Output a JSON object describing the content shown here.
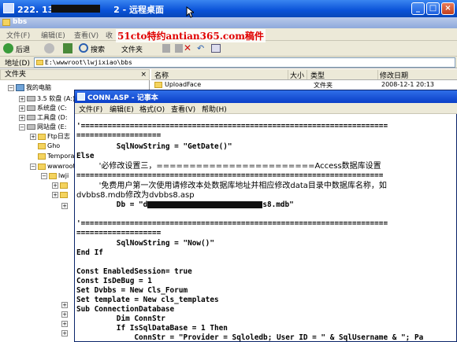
{
  "rdp_window": {
    "title_prefix": "222. 134.",
    "title_suffix": "2 - 远程桌面",
    "buttons": [
      "_",
      "□",
      "×"
    ]
  },
  "explorer": {
    "title": "bbs",
    "menu": [
      "文件(F)",
      "编辑(E)",
      "查看(V)",
      "收"
    ],
    "toolbar": {
      "back": "后退",
      "search": "搜索",
      "folders": "文件夹"
    },
    "address_label": "地址(D)",
    "address_value": "E:\\wwwroot\\lwjixiao\\bbs",
    "promo_text": "51cto特约antian365.com稿件",
    "folder_pane_title": "文件夹",
    "tree": [
      {
        "label": "我的电脑",
        "indent": 0,
        "icon": "computer-icon"
      },
      {
        "label": "3.5 软盘 (A:)",
        "indent": 1,
        "icon": "floppy-icon"
      },
      {
        "label": "系统盘 (C:",
        "indent": 1,
        "icon": "drive-icon"
      },
      {
        "label": "工具盘 (D:",
        "indent": 1,
        "icon": "drive-icon"
      },
      {
        "label": "网站盘 (E:",
        "indent": 1,
        "icon": "drive-icon"
      },
      {
        "label": "Ftp日志",
        "indent": 2,
        "icon": "folder-icon"
      },
      {
        "label": "Gho",
        "indent": 2,
        "icon": "folder-icon"
      },
      {
        "label": "Tempora",
        "indent": 2,
        "icon": "folder-icon"
      },
      {
        "label": "wwwroot",
        "indent": 2,
        "icon": "folder-icon"
      },
      {
        "label": "lwji",
        "indent": 3,
        "icon": "folder-icon"
      },
      {
        "label": "",
        "indent": 4,
        "icon": "folder-icon"
      },
      {
        "label": "",
        "indent": 4,
        "icon": "folder-icon"
      }
    ],
    "list_columns": [
      "名称",
      "大小",
      "类型",
      "修改日期"
    ],
    "list_row": {
      "name": "UploadFace",
      "type": "文件夹",
      "date": "2008-12-1 20:13"
    }
  },
  "notepad": {
    "title": "CONN.ASP - 记事本",
    "menu": [
      "文件(F)",
      "编辑(E)",
      "格式(O)",
      "查看(V)",
      "帮助(H)"
    ],
    "lines": [
      "'=====================================================================",
      "===================",
      "         SqlNowString = \"GetDate()\"",
      "Else",
      "         '必修改设置三，========================Access数据库设置",
      "=====================================================================",
      "         '免费用户第一次使用请修改本处数据库地址并相应修改data目录中数据库名称，如",
      "dvbbs8.mdb修改为dvbbs8.asp",
      "         Db = \"d",
      "",
      "'=====================================================================",
      "===================",
      "         SqlNowString = \"Now()\"",
      "End If",
      "",
      "Const EnabledSession= true",
      "Const IsDeBug = 1",
      "Set Dvbbs = New Cls_Forum",
      "Set template = New cls_templates",
      "Sub ConnectionDatabase",
      "         Dim ConnStr",
      "         If IsSqlDataBase = 1 Then",
      "             ConnStr = \"Provider = Sqloledb; User ID = \" & SqlUsername & \"; Pa"
    ],
    "db_line_tail": "s8.mdb\""
  }
}
